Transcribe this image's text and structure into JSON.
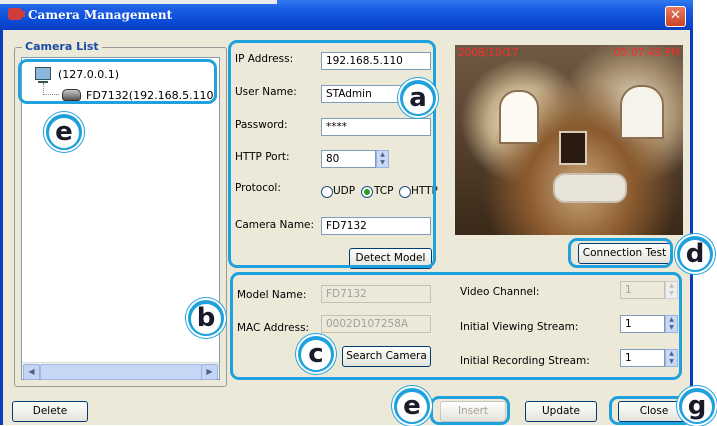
{
  "window": {
    "title": "Camera Management",
    "close_glyph": "✕"
  },
  "camera_list": {
    "legend": "Camera List",
    "items": [
      {
        "label": "(127.0.0.1)",
        "icon": "computer-icon"
      },
      {
        "label": "FD7132(192.168.5.110)",
        "icon": "camera-icon"
      }
    ]
  },
  "form": {
    "ip_label": "IP Address:",
    "ip_value": "192.168.5.110",
    "user_label": "User Name:",
    "user_value": "STAdmin",
    "password_label": "Password:",
    "password_value": "****",
    "http_port_label": "HTTP Port:",
    "http_port_value": "80",
    "protocol_label": "Protocol:",
    "protocol_options": [
      "UDP",
      "TCP",
      "HTTP"
    ],
    "protocol_selected": "TCP",
    "camera_name_label": "Camera Name:",
    "camera_name_value": "FD7132",
    "detect_model": "Detect Model"
  },
  "preview": {
    "date": "2008/10/17",
    "time": "05:07:43 PM"
  },
  "connection_test": "Connection Test",
  "details": {
    "model_name_label": "Model Name:",
    "model_name_value": "FD7132",
    "mac_label": "MAC Address:",
    "mac_value": "0002D107258A",
    "search_camera": "Search Camera",
    "video_channel_label": "Video Channel:",
    "video_channel_value": "1",
    "viewing_stream_label": "Initial Viewing Stream:",
    "viewing_stream_value": "1",
    "recording_stream_label": "Initial Recording Stream:",
    "recording_stream_value": "1"
  },
  "buttons": {
    "delete": "Delete",
    "insert": "Insert",
    "update": "Update",
    "close": "Close"
  },
  "callouts": [
    "a",
    "b",
    "c",
    "d",
    "e",
    "e",
    "g"
  ],
  "colors": {
    "callout": "#1ea1dd",
    "titlebar": "#0a4bd6",
    "timestamp": "#ff2b2b"
  }
}
